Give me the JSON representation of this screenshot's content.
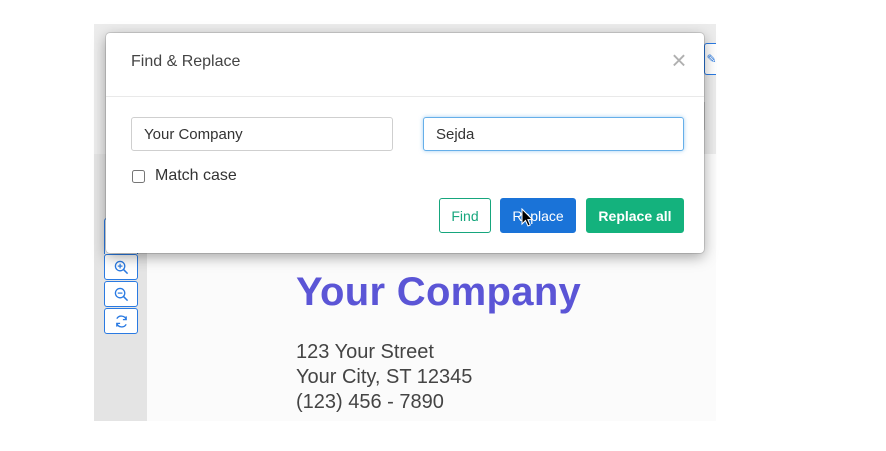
{
  "dialog": {
    "title": "Find & Replace",
    "find_value": "Your Company",
    "replace_value": "Sejda",
    "match_case_label": "Match case",
    "match_case_checked": false,
    "buttons": {
      "find": "Find",
      "replace": "Replace",
      "replace_all": "Replace all"
    }
  },
  "document": {
    "company_name": "Your Company",
    "address_lines": [
      "123 Your Street",
      "Your City, ST 12345",
      "(123) 456 - 7890"
    ]
  },
  "icons": [
    "close-icon",
    "zoom-in-icon",
    "zoom-out-icon",
    "refresh-icon",
    "pointer-cursor-icon"
  ],
  "colors": {
    "accent_blue": "#1a73d8",
    "accent_green": "#14b27d",
    "company_name": "#5b55d6"
  }
}
